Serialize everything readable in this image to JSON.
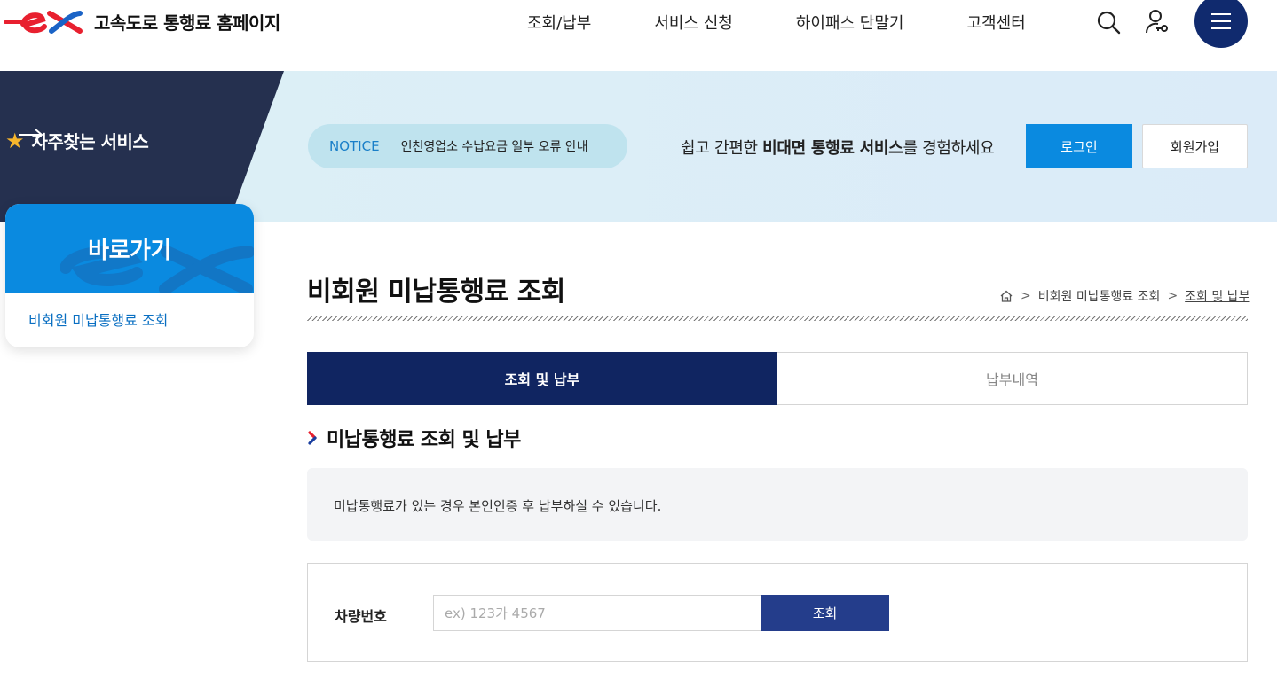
{
  "header": {
    "site_title": "고속도로 통행료 홈페이지",
    "logo_letters": "ex",
    "nav": [
      "조회/납부",
      "서비스 신청",
      "하이패스 단말기",
      "고객센터"
    ],
    "icons": [
      "search-icon",
      "user-key-icon",
      "hamburger-menu-icon"
    ]
  },
  "banner": {
    "favorites_label": "자주찾는 서비스",
    "notice_tag": "NOTICE",
    "notice_text": "인천영업소 수납요금 일부 오류 안내",
    "message_prefix": "쉽고 간편한 ",
    "message_bold": "비대면 통행료 서비스",
    "message_suffix": "를 경험하세요",
    "login_label": "로그인",
    "join_label": "회원가입"
  },
  "side": {
    "title": "바로가기",
    "link": "비회원 미납통행료 조회"
  },
  "main": {
    "title": "비회원 미납통행료 조회",
    "breadcrumb": [
      "비회원 미납통행료 조회",
      "조회 및 납부"
    ],
    "tabs": [
      "조회 및 납부",
      "납부내역"
    ],
    "active_tab": "조회 및 납부",
    "section_title": "미납통행료 조회 및 납부",
    "info_text": "미납통행료가 있는 경우 본인인증 후 납부하실 수 있습니다.",
    "form": {
      "label": "차량번호",
      "placeholder": "ex) 123가 4567",
      "value": "",
      "submit_label": "조회"
    }
  },
  "colors": {
    "brand_red": "#e8202f",
    "brand_blue": "#1a63c6",
    "navy": "#102561",
    "accent_blue": "#0a8ae0",
    "favorites_star": "#f7b52c"
  }
}
